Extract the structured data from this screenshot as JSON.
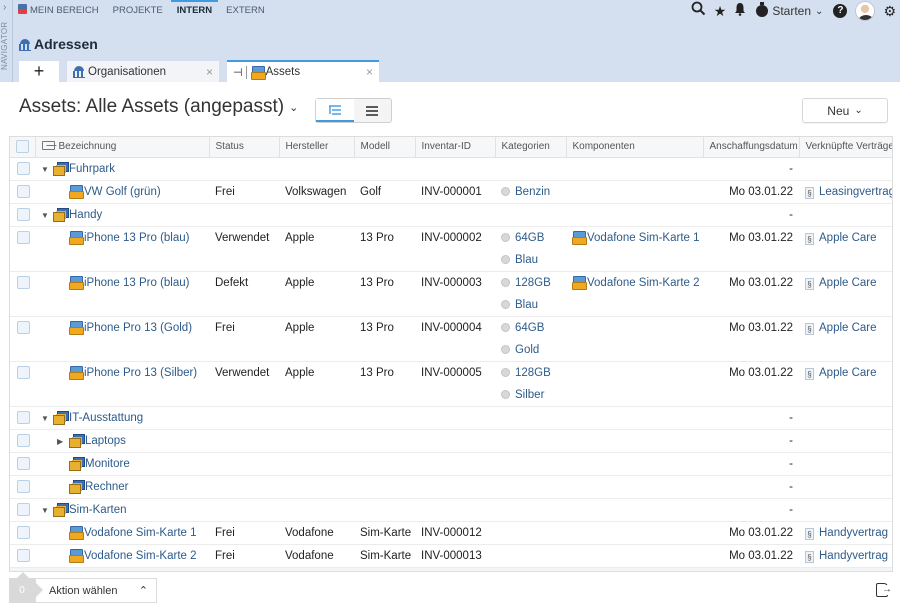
{
  "navigator": {
    "label": "NAVIGATOR",
    "expand_icon": "chevron-right"
  },
  "topnav": {
    "items": [
      {
        "label": "MEIN BEREICH",
        "active": false
      },
      {
        "label": "PROJEKTE",
        "active": false
      },
      {
        "label": "INTERN",
        "active": true
      },
      {
        "label": "EXTERN",
        "active": false
      }
    ]
  },
  "topright": {
    "icons": [
      "search-icon",
      "star-icon",
      "bell-icon"
    ],
    "starten_label": "Starten",
    "help_label": "?"
  },
  "section": {
    "title": "Adressen"
  },
  "tabs": {
    "add_label": "+",
    "items": [
      {
        "label": "Organisationen",
        "active": false,
        "close": "×"
      },
      {
        "label": "Assets",
        "active": true,
        "close": "×",
        "pin": "⊣"
      }
    ]
  },
  "view": {
    "title": "Assets: Alle Assets (angepasst)",
    "dropdown": "⌄",
    "toggle": [
      {
        "icon": "tree-view-icon",
        "glyph": "⋿",
        "active": true
      },
      {
        "icon": "list-view-icon",
        "glyph": "☰",
        "active": false
      }
    ],
    "new_button": "Neu"
  },
  "grid": {
    "columns": [
      "Bezeichnung",
      "Status",
      "Hersteller",
      "Modell",
      "Inventar-ID",
      "Kategorien",
      "Komponenten",
      "Anschaffungsdatum",
      "Verknüpfte Verträge"
    ],
    "rows": [
      {
        "type": "group",
        "level": 0,
        "toggle": "▼",
        "name": "Fuhrpark",
        "date": "-"
      },
      {
        "type": "asset",
        "level": 1,
        "name": "VW Golf (grün)",
        "status": "Frei",
        "hersteller": "Volkswagen",
        "modell": "Golf",
        "inventar": "INV-000001",
        "kategorien": [
          "Benzin"
        ],
        "komponenten": "",
        "date": "Mo 03.01.22",
        "vertrag": "Leasingvertrag"
      },
      {
        "type": "group",
        "level": 0,
        "toggle": "▼",
        "name": "Handy",
        "date": "-"
      },
      {
        "type": "asset",
        "level": 1,
        "name": "iPhone 13 Pro (blau)",
        "status": "Verwendet",
        "hersteller": "Apple",
        "modell": "13 Pro",
        "inventar": "INV-000002",
        "kategorien": [
          "64GB",
          "Blau"
        ],
        "komponenten": "Vodafone Sim-Karte 1",
        "date": "Mo 03.01.22",
        "vertrag": "Apple Care"
      },
      {
        "type": "asset",
        "level": 1,
        "name": "iPhone 13 Pro (blau)",
        "status": "Defekt",
        "hersteller": "Apple",
        "modell": "13 Pro",
        "inventar": "INV-000003",
        "kategorien": [
          "128GB",
          "Blau"
        ],
        "komponenten": "Vodafone Sim-Karte 2",
        "date": "Mo 03.01.22",
        "vertrag": "Apple Care"
      },
      {
        "type": "asset",
        "level": 1,
        "name": "iPhone Pro 13 (Gold)",
        "status": "Frei",
        "hersteller": "Apple",
        "modell": "13 Pro",
        "inventar": "INV-000004",
        "kategorien": [
          "64GB",
          "Gold"
        ],
        "komponenten": "",
        "date": "Mo 03.01.22",
        "vertrag": "Apple Care"
      },
      {
        "type": "asset",
        "level": 1,
        "name": "iPhone Pro 13 (Silber)",
        "status": "Verwendet",
        "hersteller": "Apple",
        "modell": "13 Pro",
        "inventar": "INV-000005",
        "kategorien": [
          "128GB",
          "Silber"
        ],
        "komponenten": "",
        "date": "Mo 03.01.22",
        "vertrag": "Apple Care"
      },
      {
        "type": "group",
        "level": 0,
        "toggle": "▼",
        "name": "IT-Ausstattung",
        "date": "-"
      },
      {
        "type": "group",
        "level": 1,
        "toggle": "▶",
        "name": "Laptops",
        "date": "-"
      },
      {
        "type": "group",
        "level": 1,
        "toggle": "",
        "name": "Monitore",
        "date": "-"
      },
      {
        "type": "group",
        "level": 1,
        "toggle": "",
        "name": "Rechner",
        "date": "-"
      },
      {
        "type": "group",
        "level": 0,
        "toggle": "▼",
        "name": "Sim-Karten",
        "date": "-"
      },
      {
        "type": "asset",
        "level": 1,
        "name": "Vodafone Sim-Karte 1",
        "status": "Frei",
        "hersteller": "Vodafone",
        "modell": "Sim-Karte",
        "inventar": "INV-000012",
        "kategorien": [],
        "komponenten": "",
        "date": "Mo 03.01.22",
        "vertrag": "Handyvertrag"
      },
      {
        "type": "asset",
        "level": 1,
        "name": "Vodafone Sim-Karte 2",
        "status": "Frei",
        "hersteller": "Vodafone",
        "modell": "Sim-Karte",
        "inventar": "INV-000013",
        "kategorien": [],
        "komponenten": "",
        "date": "Mo 03.01.22",
        "vertrag": "Handyvertrag"
      }
    ]
  },
  "footer": {
    "selected_count": "0",
    "action_label": "Aktion wählen",
    "action_chevron": "︿"
  },
  "colors": {
    "accent": "#3f9ae0",
    "header_bg": "#d4e0ef",
    "link": "#2d5b8a"
  }
}
